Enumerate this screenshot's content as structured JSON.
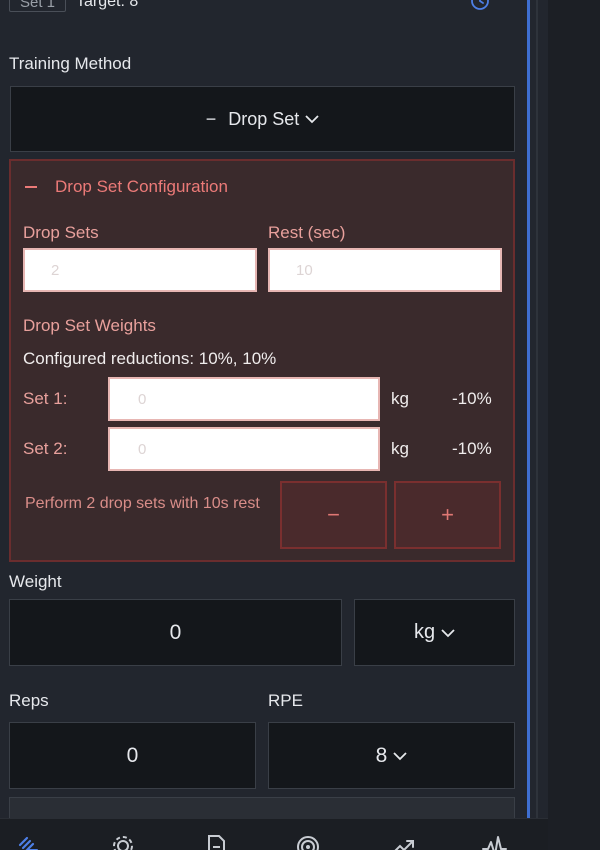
{
  "header": {
    "set_chip": "Set 1",
    "target": "Target: 8",
    "timer_icon": "clock-icon"
  },
  "training_method": {
    "label": "Training Method",
    "selected": "Drop Set",
    "icon": "minus-icon"
  },
  "drop_set_config": {
    "title": "Drop Set Configuration",
    "drop_sets_label": "Drop Sets",
    "drop_sets_placeholder": "2",
    "rest_label": "Rest (sec)",
    "rest_placeholder": "10",
    "weights_label": "Drop Set Weights",
    "configured_text": "Configured reductions: 10%, 10%",
    "sets": [
      {
        "label": "Set 1:",
        "placeholder": "0",
        "unit": "kg",
        "reduction": "-10%"
      },
      {
        "label": "Set 2:",
        "placeholder": "0",
        "unit": "kg",
        "reduction": "-10%"
      }
    ],
    "summary": "Perform 2 drop sets with 10s rest",
    "decrement_label": "−",
    "increment_label": "+"
  },
  "weight": {
    "label": "Weight",
    "value": "0",
    "unit": "kg"
  },
  "reps": {
    "label": "Reps",
    "value": "0"
  },
  "rpe": {
    "label": "RPE",
    "value": "8"
  },
  "bottom_nav": {
    "icons": [
      "dumbbell-icon",
      "gear-icon",
      "document-icon",
      "target-icon",
      "trend-icon",
      "activity-icon"
    ]
  },
  "colors": {
    "accent": "#3f6fd1",
    "danger_text": "#ec7a78",
    "panel_bg": "#3a2a2c",
    "panel_border": "#6a2d2e"
  }
}
